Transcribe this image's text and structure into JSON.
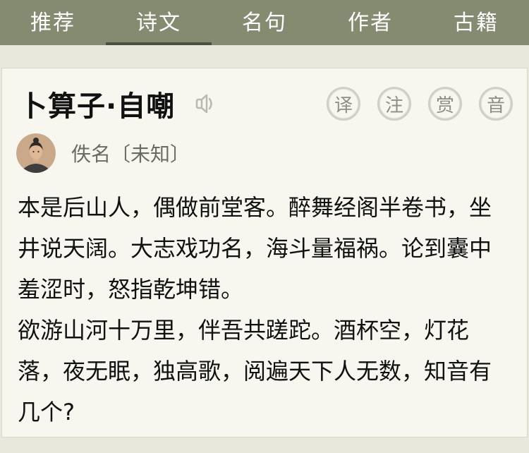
{
  "tabs": [
    {
      "label": "推荐",
      "active": false
    },
    {
      "label": "诗文",
      "active": true
    },
    {
      "label": "名句",
      "active": false
    },
    {
      "label": "作者",
      "active": false
    },
    {
      "label": "古籍",
      "active": false
    }
  ],
  "poem": {
    "title": "卜算子·自嘲",
    "author": "佚名〔未知〕",
    "actions": [
      "译",
      "注",
      "赏",
      "音"
    ],
    "paragraphs": [
      "本是后山人，偶做前堂客。醉舞经阁半卷书，坐井说天阔。大志戏功名，海斗量福祸。论到囊中羞涩时，怒指乾坤错。",
      "欲游山河十万里，伴吾共蹉跎。酒杯空，灯花落，夜无眠，独高歌，阅遍天下人无数，知音有几个?"
    ]
  },
  "colors": {
    "topbar": "#858b70",
    "active_indicator": "#4b5340",
    "background": "#e9e8dc",
    "card": "#f7f6ef"
  }
}
